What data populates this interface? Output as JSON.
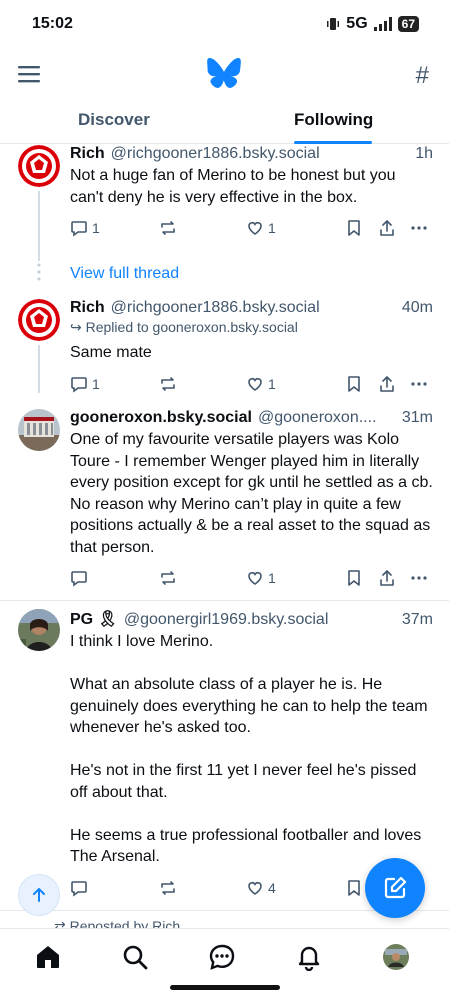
{
  "status": {
    "time": "15:02",
    "network": "5G",
    "battery": "67"
  },
  "tabs": [
    {
      "label": "Discover"
    },
    {
      "label": "Following"
    }
  ],
  "view_full_thread": "View full thread",
  "posts": [
    {
      "author": "Rich",
      "handle": "@richgooner1886.bsky.social",
      "time": "1h",
      "text": "Not a huge fan of Merino to be honest but you can't deny he is very effective in the box.",
      "replies": "1",
      "likes": "1"
    },
    {
      "author": "Rich",
      "handle": "@richgooner1886.bsky.social",
      "time": "40m",
      "reply_to": "Replied to gooneroxon.bsky.social",
      "text": "Same mate",
      "replies": "1",
      "likes": "1"
    },
    {
      "author": "gooneroxon.bsky.social",
      "handle": "@gooneroxon....",
      "time": "31m",
      "text": "One of my favourite versatile players was Kolo Toure - I remember Wenger played him in literally every position except for gk until he settled as a cb. No reason why Merino can’t play in quite a few positions actually & be a real asset to the squad as that person.",
      "replies": "",
      "likes": "1"
    },
    {
      "author": "PG 🎗",
      "handle": "@goonergirl1969.bsky.social",
      "time": "37m",
      "text": "I think I love Merino.\n\nWhat an absolute class of a player he is. He genuinely does everything he can to help the team whenever he's asked too.\n\nHe's not in the first 11 yet I never feel he's pissed off about that.\n\nHe seems a true professional footballer and loves The Arsenal.",
      "replies": "",
      "likes": "4"
    }
  ],
  "reposted_by": "Reposted by Rich",
  "colors": {
    "accent": "#1083fe",
    "muted": "#42576c",
    "arsenal_red": "#db0007"
  },
  "icons": [
    "menu-icon",
    "butterfly-logo-icon",
    "feeds-hash-icon",
    "reply-icon",
    "repost-icon",
    "like-icon",
    "bookmark-icon",
    "share-icon",
    "more-icon",
    "compose-icon",
    "arrow-up-icon",
    "home-icon",
    "search-icon",
    "chat-icon",
    "bell-icon"
  ]
}
